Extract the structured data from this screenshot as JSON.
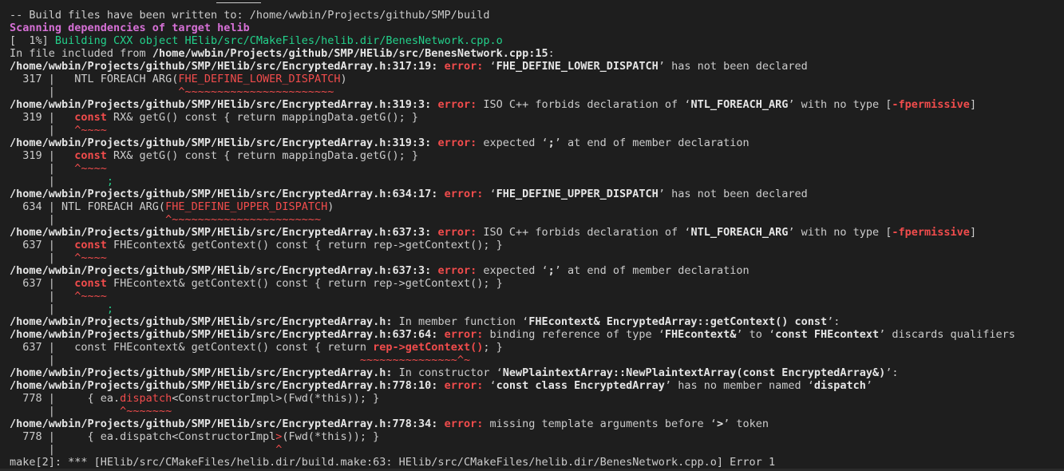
{
  "colors": {
    "background": "#1e1e1e",
    "text": "#cccccc",
    "error": "#f14c4c",
    "progress": "#23d18b",
    "scanning": "#d670d6"
  },
  "lines": [
    [
      {
        "t": "-- Build files have been written to: /home/wwbin/Projects/github/SMP/build"
      }
    ],
    [
      {
        "t": "Scanning dependencies of target helib",
        "c": "mag"
      }
    ],
    [
      {
        "t": "[  1%] "
      },
      {
        "t": "Building CXX object HElib/src/CMakeFiles/helib.dir/BenesNetwork.cpp.o",
        "c": "grn"
      }
    ],
    [
      {
        "t": "In file included from "
      },
      {
        "t": "/home/wwbin/Projects/github/SMP/HElib/src/BenesNetwork.cpp:15",
        "c": "b"
      },
      {
        "t": ":"
      }
    ],
    [
      {
        "t": "/home/wwbin/Projects/github/SMP/HElib/src/EncryptedArray.h:317:19: ",
        "c": "b"
      },
      {
        "t": "error: ",
        "c": "err"
      },
      {
        "t": "‘"
      },
      {
        "t": "FHE_DEFINE_LOWER_DISPATCH",
        "c": "b"
      },
      {
        "t": "’ has not been declared"
      }
    ],
    [
      {
        "t": "  317 |   NTL FOREACH ARG("
      },
      {
        "t": "FHE_DEFINE_LOWER_DISPATCH",
        "c": "red"
      },
      {
        "t": ")"
      }
    ],
    [
      {
        "t": "      |                   "
      },
      {
        "t": "^~~~~~~~~~~~~~~~~~~~~~~~",
        "c": "red"
      }
    ],
    [
      {
        "t": "/home/wwbin/Projects/github/SMP/HElib/src/EncryptedArray.h:319:3: ",
        "c": "b"
      },
      {
        "t": "error: ",
        "c": "err"
      },
      {
        "t": "ISO C++ forbids declaration of ‘"
      },
      {
        "t": "NTL_FOREACH_ARG",
        "c": "b"
      },
      {
        "t": "’ with no type ["
      },
      {
        "t": "-fpermissive",
        "c": "err"
      },
      {
        "t": "]"
      }
    ],
    [
      {
        "t": "  319 |   "
      },
      {
        "t": "const",
        "c": "kw"
      },
      {
        "t": " RX& getG() const { return mappingData.getG(); }"
      }
    ],
    [
      {
        "t": "      |   "
      },
      {
        "t": "^~~~~",
        "c": "red"
      }
    ],
    [
      {
        "t": "/home/wwbin/Projects/github/SMP/HElib/src/EncryptedArray.h:319:3: ",
        "c": "b"
      },
      {
        "t": "error: ",
        "c": "err"
      },
      {
        "t": "expected ‘"
      },
      {
        "t": ";",
        "c": "b"
      },
      {
        "t": "’ at end of member declaration"
      }
    ],
    [
      {
        "t": "  319 |   "
      },
      {
        "t": "const",
        "c": "kw"
      },
      {
        "t": " RX& getG() const { return mappingData.getG(); }"
      }
    ],
    [
      {
        "t": "      |   "
      },
      {
        "t": "^~~~~",
        "c": "red"
      }
    ],
    [
      {
        "t": "      |        "
      },
      {
        "t": ";",
        "c": "grn"
      }
    ],
    [
      {
        "t": "/home/wwbin/Projects/github/SMP/HElib/src/EncryptedArray.h:634:17: ",
        "c": "b"
      },
      {
        "t": "error: ",
        "c": "err"
      },
      {
        "t": "‘"
      },
      {
        "t": "FHE_DEFINE_UPPER_DISPATCH",
        "c": "b"
      },
      {
        "t": "’ has not been declared"
      }
    ],
    [
      {
        "t": "  634 | NTL FOREACH ARG("
      },
      {
        "t": "FHE_DEFINE_UPPER_DISPATCH",
        "c": "red"
      },
      {
        "t": ")"
      }
    ],
    [
      {
        "t": "      |                 "
      },
      {
        "t": "^~~~~~~~~~~~~~~~~~~~~~~~",
        "c": "red"
      }
    ],
    [
      {
        "t": "/home/wwbin/Projects/github/SMP/HElib/src/EncryptedArray.h:637:3: ",
        "c": "b"
      },
      {
        "t": "error: ",
        "c": "err"
      },
      {
        "t": "ISO C++ forbids declaration of ‘"
      },
      {
        "t": "NTL_FOREACH_ARG",
        "c": "b"
      },
      {
        "t": "’ with no type ["
      },
      {
        "t": "-fpermissive",
        "c": "err"
      },
      {
        "t": "]"
      }
    ],
    [
      {
        "t": "  637 |   "
      },
      {
        "t": "const",
        "c": "kw"
      },
      {
        "t": " FHEcontext& getContext() const { return rep->getContext(); }"
      }
    ],
    [
      {
        "t": "      |   "
      },
      {
        "t": "^~~~~",
        "c": "red"
      }
    ],
    [
      {
        "t": "/home/wwbin/Projects/github/SMP/HElib/src/EncryptedArray.h:637:3: ",
        "c": "b"
      },
      {
        "t": "error: ",
        "c": "err"
      },
      {
        "t": "expected ‘"
      },
      {
        "t": ";",
        "c": "b"
      },
      {
        "t": "’ at end of member declaration"
      }
    ],
    [
      {
        "t": "  637 |   "
      },
      {
        "t": "const",
        "c": "kw"
      },
      {
        "t": " FHEcontext& getContext() const { return rep->getContext(); }"
      }
    ],
    [
      {
        "t": "      |   "
      },
      {
        "t": "^~~~~",
        "c": "red"
      }
    ],
    [
      {
        "t": "      |        "
      },
      {
        "t": ";",
        "c": "grn"
      }
    ],
    [
      {
        "t": "/home/wwbin/Projects/github/SMP/HElib/src/EncryptedArray.h: ",
        "c": "b"
      },
      {
        "t": "In member function ‘"
      },
      {
        "t": "FHEcontext& EncryptedArray::getContext() const",
        "c": "b"
      },
      {
        "t": "’:"
      }
    ],
    [
      {
        "t": "/home/wwbin/Projects/github/SMP/HElib/src/EncryptedArray.h:637:64: ",
        "c": "b"
      },
      {
        "t": "error: ",
        "c": "err"
      },
      {
        "t": "binding reference of type ‘"
      },
      {
        "t": "FHEcontext&",
        "c": "b"
      },
      {
        "t": "’ to ‘"
      },
      {
        "t": "const FHEcontext",
        "c": "b"
      },
      {
        "t": "’ discards qualifiers"
      }
    ],
    [
      {
        "t": "  637 |   const FHEcontext& getContext() const { return "
      },
      {
        "t": "rep->getContext()",
        "c": "err"
      },
      {
        "t": "; }"
      }
    ],
    [
      {
        "t": "      |                                               "
      },
      {
        "t": "~~~~~~~~~~~~~~~^~",
        "c": "red"
      }
    ],
    [
      {
        "t": "/home/wwbin/Projects/github/SMP/HElib/src/EncryptedArray.h: ",
        "c": "b"
      },
      {
        "t": "In constructor ‘"
      },
      {
        "t": "NewPlaintextArray::NewPlaintextArray(const EncryptedArray&)",
        "c": "b"
      },
      {
        "t": "’:"
      }
    ],
    [
      {
        "t": "/home/wwbin/Projects/github/SMP/HElib/src/EncryptedArray.h:778:10: ",
        "c": "b"
      },
      {
        "t": "error: ",
        "c": "err"
      },
      {
        "t": "‘"
      },
      {
        "t": "const class EncryptedArray",
        "c": "b"
      },
      {
        "t": "’ has no member named ‘"
      },
      {
        "t": "dispatch",
        "c": "b"
      },
      {
        "t": "’"
      }
    ],
    [
      {
        "t": "  778 |     { ea."
      },
      {
        "t": "dispatch",
        "c": "red"
      },
      {
        "t": "<ConstructorImpl>(Fwd(*this)); }"
      }
    ],
    [
      {
        "t": "      |          "
      },
      {
        "t": "^~~~~~~~",
        "c": "red"
      }
    ],
    [
      {
        "t": "/home/wwbin/Projects/github/SMP/HElib/src/EncryptedArray.h:778:34: ",
        "c": "b"
      },
      {
        "t": "error: ",
        "c": "err"
      },
      {
        "t": "missing template arguments before ‘"
      },
      {
        "t": ">",
        "c": "b"
      },
      {
        "t": "’ token"
      }
    ],
    [
      {
        "t": "  778 |     { ea.dispatch<ConstructorImpl"
      },
      {
        "t": ">",
        "c": "red"
      },
      {
        "t": "(Fwd(*this)); }"
      }
    ],
    [
      {
        "t": "      |                                  "
      },
      {
        "t": "^",
        "c": "red"
      }
    ],
    [
      {
        "t": "make[2]: *** [HElib/src/CMakeFiles/helib.dir/build.make:63: HElib/src/CMakeFiles/helib.dir/BenesNetwork.cpp.o] Error 1"
      }
    ]
  ]
}
